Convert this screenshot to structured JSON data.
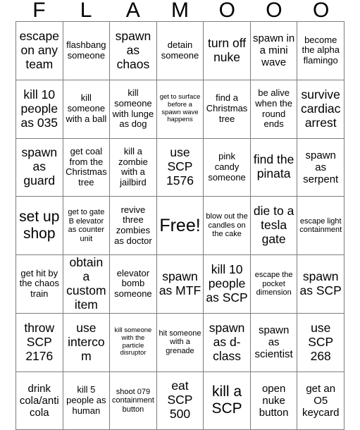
{
  "card": {
    "header_letters": [
      "F",
      "L",
      "A",
      "M",
      "O",
      "O",
      "O"
    ],
    "free_space_label": "Free!",
    "colors": {
      "background": "#ffffff",
      "text": "#000000",
      "grid_line": "#7d7d7d"
    },
    "rows": [
      [
        {
          "text": "escape on any team",
          "size": "xl"
        },
        {
          "text": "flashbang someone",
          "size": "m"
        },
        {
          "text": "spawn as chaos",
          "size": "xl"
        },
        {
          "text": "detain someone",
          "size": "m"
        },
        {
          "text": "turn off nuke",
          "size": "xl"
        },
        {
          "text": "spawn in a mini wave",
          "size": "l"
        },
        {
          "text": "become the alpha flamingo",
          "size": "m"
        }
      ],
      [
        {
          "text": "kill 10 people as 035",
          "size": "xl"
        },
        {
          "text": "kill someone with a ball",
          "size": "m"
        },
        {
          "text": "kill someone with lunge as dog",
          "size": "m"
        },
        {
          "text": "get to surface before a spawn wave happens",
          "size": "xs"
        },
        {
          "text": "find a Christmas tree",
          "size": "m"
        },
        {
          "text": "be alive when the round ends",
          "size": "m"
        },
        {
          "text": "survive cardiac arrest",
          "size": "xl"
        }
      ],
      [
        {
          "text": "spawn as guard",
          "size": "xl"
        },
        {
          "text": "get coal from the Christmas tree",
          "size": "m"
        },
        {
          "text": "kill a zombie with a jailbird",
          "size": "m"
        },
        {
          "text": "use SCP 1576",
          "size": "xl"
        },
        {
          "text": "pink candy someone",
          "size": "m"
        },
        {
          "text": "find the pinata",
          "size": "xl"
        },
        {
          "text": "spawn as serpent",
          "size": "l"
        }
      ],
      [
        {
          "text": "set up shop",
          "size": "xxl"
        },
        {
          "text": "get to gate B elevator as counter unit",
          "size": "s"
        },
        {
          "text": "revive three zombies as doctor",
          "size": "m"
        },
        {
          "text": "Free!",
          "size": "free"
        },
        {
          "text": "blow out the candles on the cake",
          "size": "s"
        },
        {
          "text": "die to a tesla gate",
          "size": "xl"
        },
        {
          "text": "escape light containment",
          "size": "s"
        }
      ],
      [
        {
          "text": "get hit by the chaos train",
          "size": "m"
        },
        {
          "text": "obtain a custom item",
          "size": "xl"
        },
        {
          "text": "elevator bomb someone",
          "size": "m"
        },
        {
          "text": "spawn as MTF",
          "size": "xl"
        },
        {
          "text": "kill 10 people as SCP",
          "size": "xl"
        },
        {
          "text": "escape the pocket dimension",
          "size": "s"
        },
        {
          "text": "spawn as SCP",
          "size": "xl"
        }
      ],
      [
        {
          "text": "throw SCP 2176",
          "size": "xl"
        },
        {
          "text": "use intercom",
          "size": "xl"
        },
        {
          "text": "kill someone with the particle disruptor",
          "size": "xs"
        },
        {
          "text": "hit someone with a grenade",
          "size": "s"
        },
        {
          "text": "spawn as d-class",
          "size": "xl"
        },
        {
          "text": "spawn as scientist",
          "size": "l"
        },
        {
          "text": "use SCP 268",
          "size": "xl"
        }
      ],
      [
        {
          "text": "drink cola/anti cola",
          "size": "l"
        },
        {
          "text": "kill 5 people as human",
          "size": "m"
        },
        {
          "text": "shoot 079 containment button",
          "size": "s"
        },
        {
          "text": "eat SCP 500",
          "size": "xl"
        },
        {
          "text": "kill a SCP",
          "size": "xxl"
        },
        {
          "text": "open nuke button",
          "size": "l"
        },
        {
          "text": "get an O5 keycard",
          "size": "l"
        }
      ]
    ]
  }
}
